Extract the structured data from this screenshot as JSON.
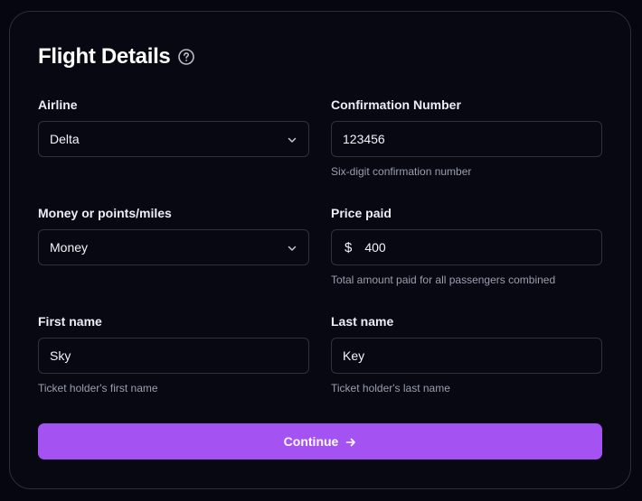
{
  "form": {
    "title": "Flight Details",
    "help_icon": "question-circle-icon",
    "airline": {
      "label": "Airline",
      "value": "Delta",
      "icon": "chevron-down-icon"
    },
    "confirmation": {
      "label": "Confirmation Number",
      "value": "123456",
      "help": "Six-digit confirmation number"
    },
    "payment_type": {
      "label": "Money or points/miles",
      "value": "Money",
      "icon": "chevron-down-icon"
    },
    "price": {
      "label": "Price paid",
      "currency_symbol": "$",
      "value": "400",
      "help": "Total amount paid for all passengers combined"
    },
    "first_name": {
      "label": "First name",
      "value": "Sky",
      "help": "Ticket holder's first name"
    },
    "last_name": {
      "label": "Last name",
      "value": "Key",
      "help": "Ticket holder's last name"
    },
    "continue_label": "Continue",
    "continue_icon": "arrow-right-icon"
  },
  "colors": {
    "background": "#05060f",
    "card": "#070812",
    "border": "#2e3140",
    "accent": "#a552f2",
    "help_text": "#9a9eae"
  }
}
